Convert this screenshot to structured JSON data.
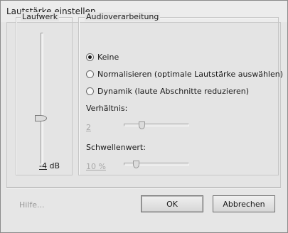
{
  "window": {
    "title": "Lautstärke einstellen"
  },
  "laufwerk": {
    "legend": "Laufwerk",
    "value_number": "-4",
    "value_unit": " dB",
    "slider_position_fraction": 0.62
  },
  "audio": {
    "legend": "Audioverarbeitung",
    "options": [
      {
        "label": "Keine",
        "checked": true
      },
      {
        "label": "Normalisieren (optimale Lautstärke auswählen)",
        "checked": false
      },
      {
        "label": "Dynamik (laute Abschnitte reduzieren)",
        "checked": false
      }
    ],
    "ratio": {
      "label": "Verhältnis:",
      "value": "2",
      "enabled": false
    },
    "threshold": {
      "label": "Schwellenwert:",
      "value": "10 %",
      "enabled": false
    }
  },
  "footer": {
    "help_label": "Hilfe...",
    "ok_label": "OK",
    "cancel_label": "Abbrechen"
  },
  "colors": {
    "dialog_bg": "#e6e6e6",
    "disabled_text": "#a8a8a8",
    "help_text": "#9a9a9a"
  }
}
